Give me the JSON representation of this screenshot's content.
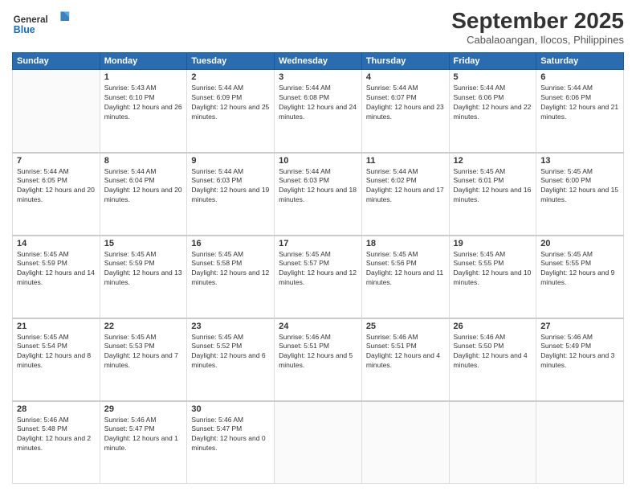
{
  "header": {
    "logo_general": "General",
    "logo_blue": "Blue",
    "month_title": "September 2025",
    "location": "Cabalaoangan, Ilocos, Philippines"
  },
  "weekdays": [
    "Sunday",
    "Monday",
    "Tuesday",
    "Wednesday",
    "Thursday",
    "Friday",
    "Saturday"
  ],
  "weeks": [
    [
      {
        "day": "",
        "empty": true
      },
      {
        "day": "1",
        "sunrise": "5:43 AM",
        "sunset": "6:10 PM",
        "daylight": "12 hours and 26 minutes."
      },
      {
        "day": "2",
        "sunrise": "5:44 AM",
        "sunset": "6:09 PM",
        "daylight": "12 hours and 25 minutes."
      },
      {
        "day": "3",
        "sunrise": "5:44 AM",
        "sunset": "6:08 PM",
        "daylight": "12 hours and 24 minutes."
      },
      {
        "day": "4",
        "sunrise": "5:44 AM",
        "sunset": "6:07 PM",
        "daylight": "12 hours and 23 minutes."
      },
      {
        "day": "5",
        "sunrise": "5:44 AM",
        "sunset": "6:06 PM",
        "daylight": "12 hours and 22 minutes."
      },
      {
        "day": "6",
        "sunrise": "5:44 AM",
        "sunset": "6:06 PM",
        "daylight": "12 hours and 21 minutes."
      }
    ],
    [
      {
        "day": "7",
        "sunrise": "5:44 AM",
        "sunset": "6:05 PM",
        "daylight": "12 hours and 20 minutes."
      },
      {
        "day": "8",
        "sunrise": "5:44 AM",
        "sunset": "6:04 PM",
        "daylight": "12 hours and 20 minutes."
      },
      {
        "day": "9",
        "sunrise": "5:44 AM",
        "sunset": "6:03 PM",
        "daylight": "12 hours and 19 minutes."
      },
      {
        "day": "10",
        "sunrise": "5:44 AM",
        "sunset": "6:03 PM",
        "daylight": "12 hours and 18 minutes."
      },
      {
        "day": "11",
        "sunrise": "5:44 AM",
        "sunset": "6:02 PM",
        "daylight": "12 hours and 17 minutes."
      },
      {
        "day": "12",
        "sunrise": "5:45 AM",
        "sunset": "6:01 PM",
        "daylight": "12 hours and 16 minutes."
      },
      {
        "day": "13",
        "sunrise": "5:45 AM",
        "sunset": "6:00 PM",
        "daylight": "12 hours and 15 minutes."
      }
    ],
    [
      {
        "day": "14",
        "sunrise": "5:45 AM",
        "sunset": "5:59 PM",
        "daylight": "12 hours and 14 minutes."
      },
      {
        "day": "15",
        "sunrise": "5:45 AM",
        "sunset": "5:59 PM",
        "daylight": "12 hours and 13 minutes."
      },
      {
        "day": "16",
        "sunrise": "5:45 AM",
        "sunset": "5:58 PM",
        "daylight": "12 hours and 12 minutes."
      },
      {
        "day": "17",
        "sunrise": "5:45 AM",
        "sunset": "5:57 PM",
        "daylight": "12 hours and 12 minutes."
      },
      {
        "day": "18",
        "sunrise": "5:45 AM",
        "sunset": "5:56 PM",
        "daylight": "12 hours and 11 minutes."
      },
      {
        "day": "19",
        "sunrise": "5:45 AM",
        "sunset": "5:55 PM",
        "daylight": "12 hours and 10 minutes."
      },
      {
        "day": "20",
        "sunrise": "5:45 AM",
        "sunset": "5:55 PM",
        "daylight": "12 hours and 9 minutes."
      }
    ],
    [
      {
        "day": "21",
        "sunrise": "5:45 AM",
        "sunset": "5:54 PM",
        "daylight": "12 hours and 8 minutes."
      },
      {
        "day": "22",
        "sunrise": "5:45 AM",
        "sunset": "5:53 PM",
        "daylight": "12 hours and 7 minutes."
      },
      {
        "day": "23",
        "sunrise": "5:45 AM",
        "sunset": "5:52 PM",
        "daylight": "12 hours and 6 minutes."
      },
      {
        "day": "24",
        "sunrise": "5:46 AM",
        "sunset": "5:51 PM",
        "daylight": "12 hours and 5 minutes."
      },
      {
        "day": "25",
        "sunrise": "5:46 AM",
        "sunset": "5:51 PM",
        "daylight": "12 hours and 4 minutes."
      },
      {
        "day": "26",
        "sunrise": "5:46 AM",
        "sunset": "5:50 PM",
        "daylight": "12 hours and 4 minutes."
      },
      {
        "day": "27",
        "sunrise": "5:46 AM",
        "sunset": "5:49 PM",
        "daylight": "12 hours and 3 minutes."
      }
    ],
    [
      {
        "day": "28",
        "sunrise": "5:46 AM",
        "sunset": "5:48 PM",
        "daylight": "12 hours and 2 minutes."
      },
      {
        "day": "29",
        "sunrise": "5:46 AM",
        "sunset": "5:47 PM",
        "daylight": "12 hours and 1 minute."
      },
      {
        "day": "30",
        "sunrise": "5:46 AM",
        "sunset": "5:47 PM",
        "daylight": "12 hours and 0 minutes."
      },
      {
        "day": "",
        "empty": true
      },
      {
        "day": "",
        "empty": true
      },
      {
        "day": "",
        "empty": true
      },
      {
        "day": "",
        "empty": true
      }
    ]
  ]
}
